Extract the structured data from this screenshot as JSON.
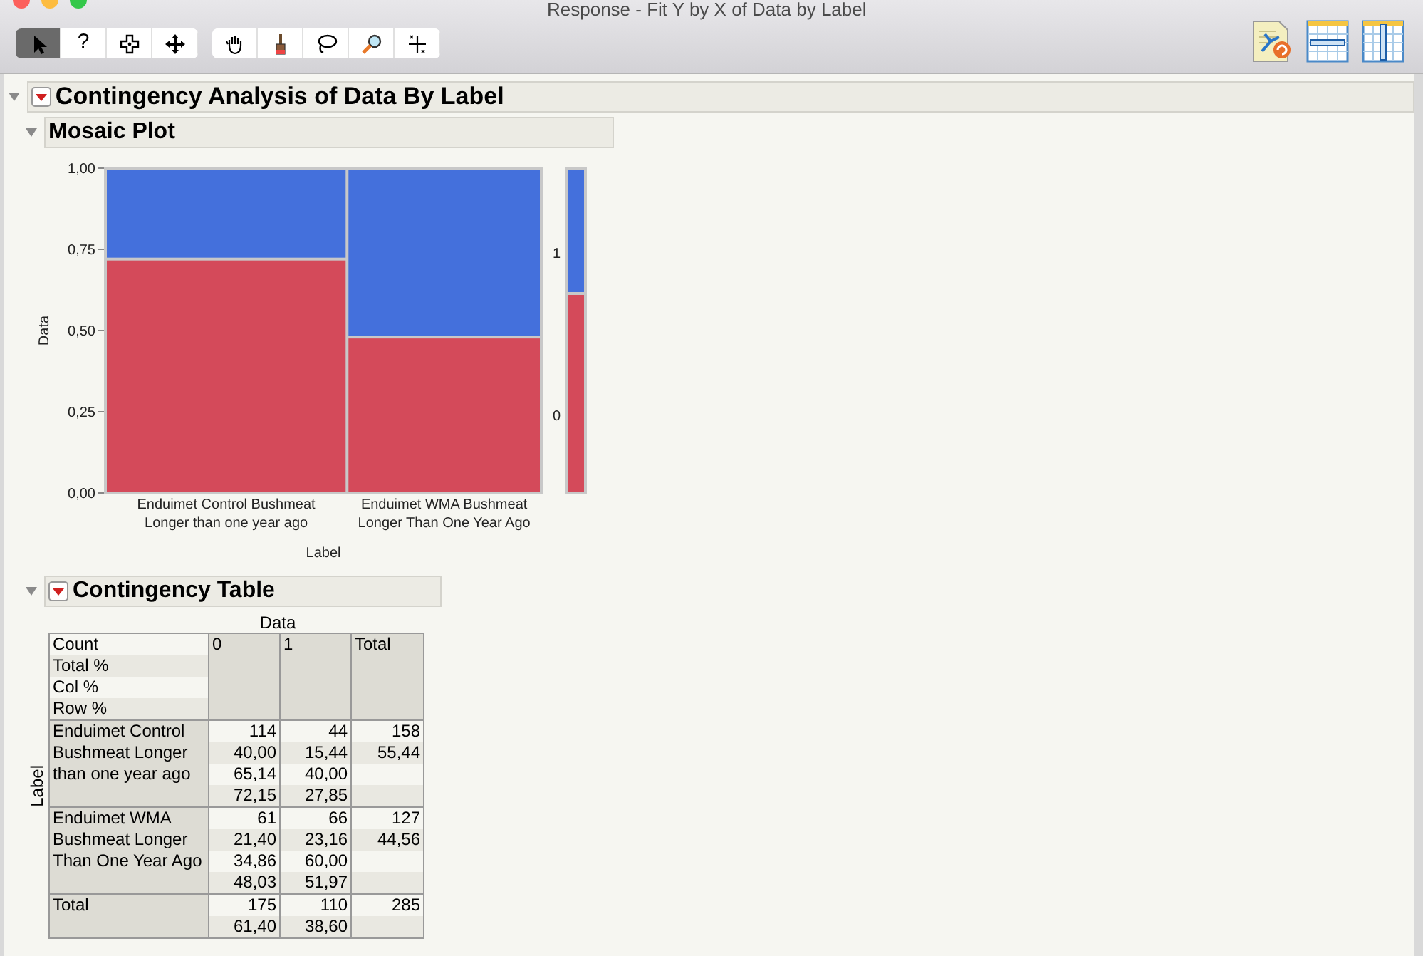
{
  "window": {
    "title": "Response - Fit Y by X of Data by Label"
  },
  "toolbar": {
    "tools": [
      {
        "kind": "arrow",
        "selected": true
      },
      {
        "kind": "help",
        "label": "?",
        "selected": false
      },
      {
        "kind": "crosshair",
        "selected": false
      },
      {
        "kind": "move",
        "selected": false
      },
      {
        "kind": "hand",
        "selected": false
      },
      {
        "kind": "brush",
        "selected": false
      },
      {
        "kind": "lasso",
        "selected": false
      },
      {
        "kind": "magnifier",
        "selected": false
      },
      {
        "kind": "scaler",
        "selected": false
      }
    ]
  },
  "report": {
    "title": "Contingency Analysis of Data By Label",
    "expanded": true,
    "menu": true,
    "sections": [
      {
        "kind": "mosaic",
        "title": "Mosaic Plot",
        "expanded": true,
        "chart_data": {
          "type": "bar",
          "stacked": true,
          "xlabel": "Label",
          "ylabel": "Data",
          "categories": [
            "Enduimet Control Bushmeat Longer than one year ago",
            "Enduimet WMA Bushmeat Longer Than One Year Ago"
          ],
          "series": [
            {
              "name": "0",
              "color": "#d44a5a",
              "values": [
                0.72,
                0.48
              ]
            },
            {
              "name": "1",
              "color": "#4470dc",
              "values": [
                0.28,
                0.52
              ]
            }
          ],
          "ylim": [
            0,
            1
          ],
          "yticks": [
            {
              "value": 0,
              "label": "0,00"
            },
            {
              "value": 0.25,
              "label": "0,25"
            },
            {
              "value": 0.5,
              "label": "0,50"
            },
            {
              "value": 0.75,
              "label": "0,75"
            },
            {
              "value": 1,
              "label": "1,00"
            }
          ]
        }
      },
      {
        "kind": "table",
        "title": "Contingency Table",
        "expanded": true,
        "menu": true,
        "column_header": "Data",
        "row_header": "Label",
        "stat_labels": [
          "Count",
          "Total %",
          "Col %",
          "Row %"
        ],
        "columns": [
          "0",
          "1",
          "Total"
        ],
        "rows": [
          {
            "label": "Enduimet Control Bushmeat Longer than one year ago",
            "cells": [
              [
                "114",
                "40,00",
                "65,14",
                "72,15"
              ],
              [
                "44",
                "15,44",
                "40,00",
                "27,85"
              ],
              [
                "158",
                "55,44"
              ]
            ]
          },
          {
            "label": "Enduimet WMA Bushmeat Longer Than One Year Ago",
            "cells": [
              [
                "61",
                "21,40",
                "34,86",
                "48,03"
              ],
              [
                "66",
                "23,16",
                "60,00",
                "51,97"
              ],
              [
                "127",
                "44,56"
              ]
            ]
          },
          {
            "label": "Total",
            "cells": [
              [
                "175",
                "61,40"
              ],
              [
                "110",
                "38,60"
              ],
              [
                "285"
              ]
            ]
          }
        ]
      }
    ]
  }
}
